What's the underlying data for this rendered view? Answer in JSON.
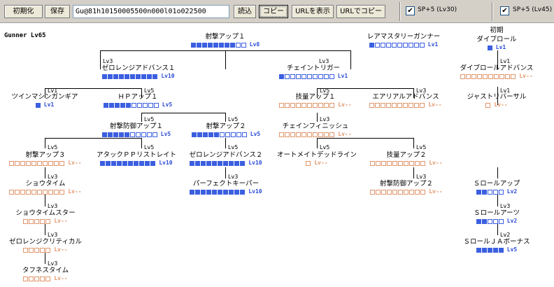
{
  "toolbar": {
    "reset": "初期化",
    "save": "保存",
    "code": "Gu@81h10150005500n000l01o022500",
    "load": "読込",
    "copy": "コピー",
    "show_url": "URLを表示",
    "copy_url": "URLでコピー",
    "sp30_label": "SP+5 (Lv30)",
    "sp45_label": "SP+5 (Lv45)",
    "sp30_checked": "✔",
    "sp45_checked": "✔"
  },
  "class_label": "Gunner Lv65",
  "colors": {
    "active": "#3b5fe0",
    "inactive": "#e0956b"
  },
  "req": {
    "r_zero1": "Lv3",
    "r_chain": "Lv3",
    "r_dive_adv": "Lv1",
    "r_justre": "Lv1",
    "r_twin": "Lv1",
    "r_hp1": "Lv5",
    "r_tech1": "Lv5",
    "r_aerial": "Lv3",
    "r_shaboh1": "Lv5",
    "r_shageki2": "Lv5",
    "r_chainfin": "Lv3",
    "r_shageki3": "Lv5",
    "r_attack_pp": "Lv5",
    "r_zero2": "Lv5",
    "r_auto": "Lv5",
    "r_tech2": "Lv5",
    "r_perfect": "Lv3",
    "r_shabo2": "Lv3",
    "r_showtime": "Lv3",
    "r_showstar": "Lv3",
    "r_zerocrit": "Lv3",
    "r_tough": "Lv3",
    "r_sroll_arts": "Lv3",
    "r_sroll_ja": "Lv2"
  },
  "skills": {
    "shageki1": {
      "name": "射撃アップ１",
      "level": "Lv8",
      "filled": 8,
      "max": 10
    },
    "rare_mastery": {
      "name": "レアマスタリーガンナー",
      "level": "Lv1",
      "filled": 1,
      "max": 10
    },
    "dive_roll": {
      "name1": "初期",
      "name2": "ダイブロール",
      "level": "Lv1",
      "filled": 1,
      "max": 1
    },
    "zero_range1": {
      "name": "ゼロレンジアドバンス１",
      "level": "Lv10",
      "filled": 10,
      "max": 10
    },
    "chain_trigger": {
      "name": "チェイントリガー",
      "level": "Lv1",
      "filled": 1,
      "max": 10
    },
    "dive_adv": {
      "name": "ダイブロールアドバンス",
      "level": "Lv--",
      "filled": 0,
      "max": 10
    },
    "twin": {
      "name": "ツインマシンガンギア",
      "level": "Lv1",
      "filled": 1,
      "max": 1
    },
    "hp1": {
      "name": "ＨＰアップ１",
      "level": "Lv5",
      "filled": 5,
      "max": 10
    },
    "tech1": {
      "name": "技量アップ１",
      "level": "Lv--",
      "filled": 0,
      "max": 10
    },
    "aerial": {
      "name": "エアリアルアドバンス",
      "level": "Lv--",
      "filled": 0,
      "max": 10
    },
    "just_reversal": {
      "name": "ジャストリバーサル",
      "level": "Lv--",
      "filled": 0,
      "max": 1
    },
    "shaboh1": {
      "name": "射撃防御アップ１",
      "level": "Lv5",
      "filled": 5,
      "max": 10
    },
    "shageki2": {
      "name": "射撃アップ２",
      "level": "Lv5",
      "filled": 5,
      "max": 10
    },
    "chain_finish": {
      "name": "チェインフィニッシュ",
      "level": "Lv--",
      "filled": 0,
      "max": 10
    },
    "shageki3": {
      "name": "射撃アップ３",
      "level": "Lv--",
      "filled": 0,
      "max": 10
    },
    "attack_pp": {
      "name": "アタックＰＰリストレイト",
      "level": "Lv10",
      "filled": 10,
      "max": 10
    },
    "zero_range2": {
      "name": "ゼロレンジアドバンス２",
      "level": "Lv10",
      "filled": 10,
      "max": 10
    },
    "auto_mate": {
      "name": "オートメイトデッドライン",
      "level": "Lv--",
      "filled": 0,
      "max": 1
    },
    "tech2": {
      "name": "技量アップ２",
      "level": "Lv--",
      "filled": 0,
      "max": 10
    },
    "showtime": {
      "name": "ショウタイム",
      "level": "Lv--",
      "filled": 0,
      "max": 10
    },
    "perfect_keeper": {
      "name": "パーフェクトキーパー",
      "level": "Lv10",
      "filled": 10,
      "max": 10
    },
    "shabo2": {
      "name": "射撃防御アップ２",
      "level": "Lv--",
      "filled": 0,
      "max": 10
    },
    "sroll_up": {
      "name": "Ｓロールアップ",
      "level": "Lv2",
      "filled": 2,
      "max": 5
    },
    "showtime_star": {
      "name": "ショウタイムスター",
      "level": "Lv--",
      "filled": 0,
      "max": 5
    },
    "sroll_arts": {
      "name": "Ｓロールアーツ",
      "level": "Lv2",
      "filled": 2,
      "max": 5
    },
    "zero_crit": {
      "name": "ゼロレンジクリティカル",
      "level": "Lv--",
      "filled": 0,
      "max": 5
    },
    "sroll_ja": {
      "name": "ＳロールＪＡボーナス",
      "level": "Lv5",
      "filled": 5,
      "max": 5
    },
    "toughness": {
      "name": "タフネスタイム",
      "level": "Lv--",
      "filled": 0,
      "max": 5
    }
  }
}
